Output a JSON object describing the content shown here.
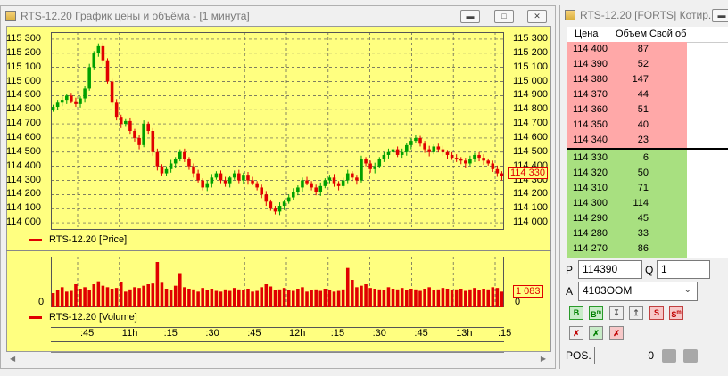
{
  "chart_window": {
    "title": "RTS-12.20 График цены и объёма - [1 минута]",
    "price_legend": "RTS-12.20 [Price]",
    "volume_legend": "RTS-12.20 [Volume]",
    "price_ticks": [
      "115 300",
      "115 200",
      "115 100",
      "115 000",
      "114 900",
      "114 800",
      "114 700",
      "114 600",
      "114 500",
      "114 400",
      "114 300",
      "114 200",
      "114 100",
      "114 000"
    ],
    "last_price_label": "114 330",
    "volume_tick_left": "0",
    "volume_tick_right": "0",
    "last_volume_label": "1 083",
    "time_ticks": [
      ":45",
      "11h",
      ":15",
      ":30",
      ":45",
      "12h",
      ":15",
      ":30",
      ":45",
      "13h",
      ":15"
    ],
    "colors": {
      "plot_bg": "#ffff80",
      "up": "#00a000",
      "down": "#e00000",
      "volume": "#e00000",
      "grid": "#555555"
    }
  },
  "chart_data": [
    {
      "type": "candlestick",
      "title": "",
      "ylim": [
        113950,
        115350
      ],
      "x": [
        ":45",
        "11h",
        ":15",
        ":30",
        ":45",
        "12h",
        ":15",
        ":30",
        ":45",
        "13h",
        ":15"
      ],
      "close_series": [
        114820,
        114850,
        114870,
        114900,
        114860,
        114840,
        114880,
        114950,
        115100,
        115200,
        115250,
        115150,
        115000,
        114850,
        114750,
        114700,
        114720,
        114650,
        114600,
        114550,
        114700,
        114650,
        114500,
        114400,
        114350,
        114380,
        114420,
        114450,
        114500,
        114450,
        114400,
        114350,
        114300,
        114250,
        114280,
        114320,
        114350,
        114300,
        114280,
        114320,
        114350,
        114300,
        114340,
        114300,
        114280,
        114250,
        114200,
        114150,
        114100,
        114080,
        114120,
        114150,
        114180,
        114220,
        114250,
        114300,
        114280,
        114250,
        114220,
        114260,
        114300,
        114320,
        114280,
        114260,
        114300,
        114350,
        114320,
        114300,
        114450,
        114420,
        114380,
        114400,
        114450,
        114480,
        114500,
        114520,
        114480,
        114500,
        114550,
        114580,
        114600,
        114560,
        114520,
        114500,
        114540,
        114520,
        114500,
        114480,
        114460,
        114450,
        114440,
        114420,
        114450,
        114480,
        114460,
        114440,
        114420,
        114380,
        114350,
        114330
      ],
      "volume_series": [
        180,
        220,
        260,
        200,
        210,
        300,
        240,
        260,
        220,
        300,
        340,
        280,
        260,
        240,
        250,
        330,
        200,
        230,
        260,
        250,
        280,
        300,
        310,
        600,
        320,
        240,
        220,
        280,
        450,
        260,
        240,
        230,
        200,
        250,
        220,
        240,
        210,
        200,
        230,
        210,
        250,
        230,
        220,
        240,
        200,
        210,
        260,
        300,
        270,
        220,
        230,
        250,
        220,
        210,
        240,
        260,
        200,
        220,
        230,
        210,
        240,
        220,
        200,
        210,
        230,
        520,
        360,
        260,
        280,
        300,
        250,
        240,
        230,
        220,
        260,
        240,
        230,
        250,
        220,
        240,
        230,
        210,
        240,
        260,
        220,
        230,
        250,
        240,
        220,
        230,
        240,
        210,
        230,
        250,
        220,
        240,
        230,
        260,
        250,
        200
      ]
    }
  ],
  "orderbook": {
    "title": "RTS-12.20 [FORTS] Котир...",
    "headers": [
      "Цена",
      "Объем",
      "Свой об"
    ],
    "asks": [
      {
        "price": "114 400",
        "volume": "87"
      },
      {
        "price": "114 390",
        "volume": "52"
      },
      {
        "price": "114 380",
        "volume": "147"
      },
      {
        "price": "114 370",
        "volume": "44"
      },
      {
        "price": "114 360",
        "volume": "51"
      },
      {
        "price": "114 350",
        "volume": "40"
      },
      {
        "price": "114 340",
        "volume": "23"
      }
    ],
    "bids": [
      {
        "price": "114 330",
        "volume": "6"
      },
      {
        "price": "114 320",
        "volume": "50"
      },
      {
        "price": "114 310",
        "volume": "71"
      },
      {
        "price": "114 300",
        "volume": "114"
      },
      {
        "price": "114 290",
        "volume": "45"
      },
      {
        "price": "114 280",
        "volume": "33"
      },
      {
        "price": "114 270",
        "volume": "86"
      }
    ],
    "colors": {
      "ask": "#ffa8a8",
      "bid": "#a8e080"
    }
  },
  "order_form": {
    "price_label": "P",
    "price_value": "114390",
    "qty_label": "Q",
    "qty_value": "1",
    "account_label": "A",
    "account_value": "4103OOM",
    "pos_label": "POS.",
    "pos_value": "0",
    "buttons": [
      "B",
      "B",
      "buy-stop",
      "sell-stop",
      "S",
      "S"
    ],
    "buttons2": [
      "cancel-all",
      "cancel-buy",
      "cancel-sell"
    ]
  }
}
